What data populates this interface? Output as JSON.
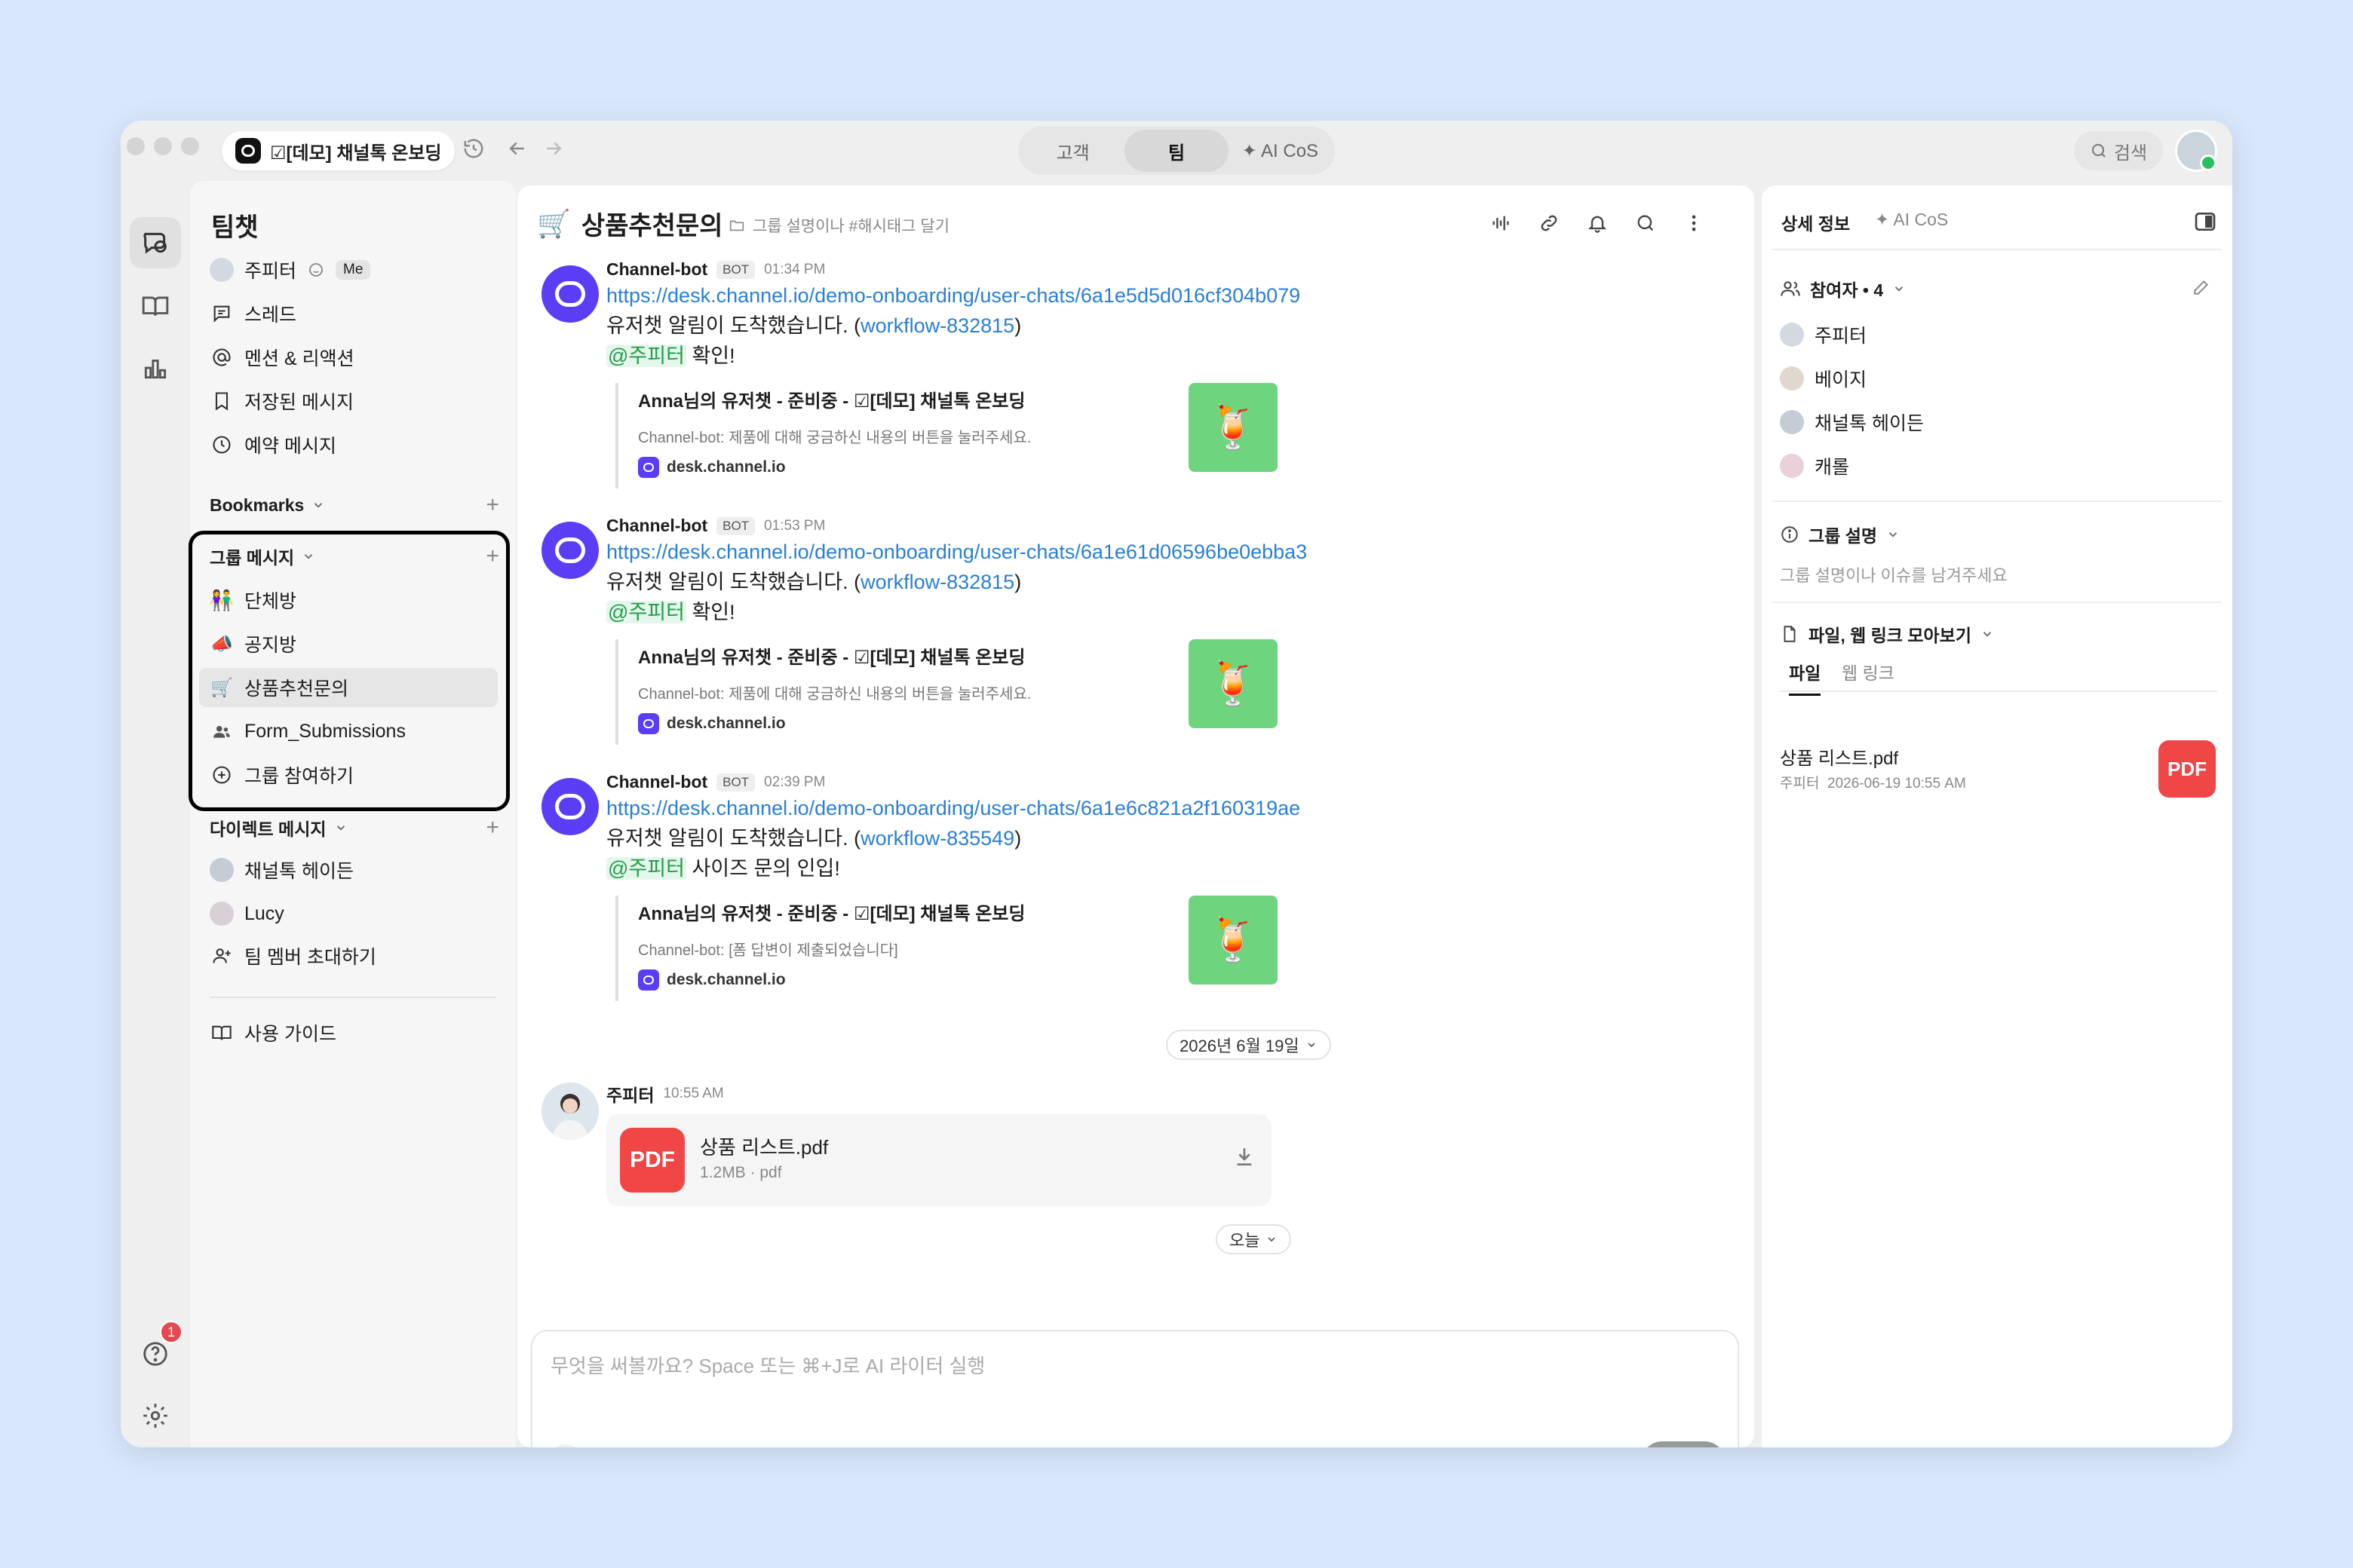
{
  "titlebar": {
    "tab_title": "☑[데모] 채널톡 온보딩",
    "segments": [
      "고객",
      "팀",
      "✦ AI CoS"
    ],
    "active_segment": "팀",
    "search_label": "검색"
  },
  "sidebar": {
    "title": "팀챗",
    "me_name": "주피터",
    "me_badge": "Me",
    "nav": [
      "스레드",
      "멘션 & 리액션",
      "저장된 메시지",
      "예약 메시지"
    ],
    "bookmarks_label": "Bookmarks",
    "group_label": "그룹 메시지",
    "groups": [
      {
        "icon": "people-emoji-icon",
        "label": "단체방"
      },
      {
        "icon": "megaphone-lock-icon",
        "label": "공지방"
      },
      {
        "icon": "cart-icon",
        "label": "상품추천문의"
      },
      {
        "icon": "people-icon",
        "label": "Form_Submissions"
      },
      {
        "icon": "plus-circle-icon",
        "label": "그룹 참여하기"
      }
    ],
    "active_group": "상품추천문의",
    "dm_label": "다이렉트 메시지",
    "dms": [
      "채널톡 헤이든",
      "Lucy"
    ],
    "invite_label": "팀 멤버 초대하기",
    "guide_label": "사용 가이드",
    "help_badge_count": "1"
  },
  "chat": {
    "title": "상품추천문의",
    "subtitle": "그룹 설명이나 #해시태그 달기",
    "messages": [
      {
        "sender": "Channel-bot",
        "bot_badge": "BOT",
        "time": "01:34 PM",
        "url": "https://desk.channel.io/demo-onboarding/user-chats/6a1e5d5d016cf304b079",
        "line_prefix": "유저챗 알림이 도착했습니다. (",
        "workflow": "workflow-832815",
        "line_suffix": ")",
        "mention": "@주피터",
        "mention_text": " 확인!",
        "card_title": "Anna님의 유저챗 - 준비중 - ☑[데모] 채널톡 온보딩",
        "card_desc": "Channel-bot: 제품에 대해 궁금하신 내용의 버튼을 눌러주세요.",
        "card_site": "desk.channel.io"
      },
      {
        "sender": "Channel-bot",
        "bot_badge": "BOT",
        "time": "01:53 PM",
        "url": "https://desk.channel.io/demo-onboarding/user-chats/6a1e61d06596be0ebba3",
        "line_prefix": "유저챗 알림이 도착했습니다. (",
        "workflow": "workflow-832815",
        "line_suffix": ")",
        "mention": "@주피터",
        "mention_text": " 확인!",
        "card_title": "Anna님의 유저챗 - 준비중 - ☑[데모] 채널톡 온보딩",
        "card_desc": "Channel-bot: 제품에 대해 궁금하신 내용의 버튼을 눌러주세요.",
        "card_site": "desk.channel.io"
      },
      {
        "sender": "Channel-bot",
        "bot_badge": "BOT",
        "time": "02:39 PM",
        "url": "https://desk.channel.io/demo-onboarding/user-chats/6a1e6c821a2f160319ae",
        "line_prefix": "유저챗 알림이 도착했습니다. (",
        "workflow": "workflow-835549",
        "line_suffix": ")",
        "mention": "@주피터",
        "mention_text": " 사이즈 문의 인입!",
        "card_title": "Anna님의 유저챗 - 준비중 - ☑[데모] 채널톡 온보딩",
        "card_desc": "Channel-bot: [폼 답변이 제출되었습니다]",
        "card_site": "desk.channel.io"
      }
    ],
    "date_divider": "2026년 6월 19일",
    "user_message": {
      "sender": "주피터",
      "time": "10:55 AM",
      "file_name": "상품 리스트.pdf",
      "file_meta": "1.2MB · pdf",
      "file_icon": "PDF"
    },
    "today_divider": "오늘",
    "composer_placeholder": "무엇을 써볼까요? Space 또는 ⌘+J로 AI 라이터 실행"
  },
  "right_panel": {
    "tabs": [
      "상세 정보",
      "✦ AI CoS"
    ],
    "participants_label": "참여자 • 4",
    "participants": [
      "주피터",
      "베이지",
      "채널톡 헤이든",
      "캐롤"
    ],
    "group_desc_label": "그룹 설명",
    "group_desc_placeholder": "그룹 설명이나 이슈를 남겨주세요",
    "files_label": "파일, 웹 링크 모아보기",
    "file_tabs": [
      "파일",
      "웹 링크"
    ],
    "file": {
      "name": "상품 리스트.pdf",
      "author": "주피터",
      "date": "2026-06-19 10:55 AM",
      "icon": "PDF"
    }
  }
}
